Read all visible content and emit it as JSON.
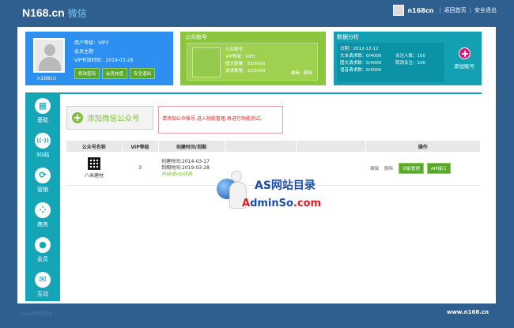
{
  "header": {
    "logo_text": "N168.cn",
    "logo_sub": "微信",
    "username": "n168cn",
    "links": [
      "返回首页",
      "安全退出"
    ]
  },
  "profile": {
    "name": "n168cn",
    "lines": [
      "用户等级：VIP3",
      "会员主题",
      "VIP有效时间：2019-03-28"
    ],
    "buttons": [
      "修改密码",
      "会员充值",
      "安全退出"
    ]
  },
  "account_card": {
    "title": "公众账号",
    "lines": [
      "公众账号：",
      "VIP等级：VIP3",
      "图文数量：33/5000",
      "请求数量：33/5000"
    ],
    "links": [
      "编辑",
      "删除"
    ]
  },
  "stats_card": {
    "title": "数据分析",
    "items": [
      "日期：2012-12-12",
      "",
      "文本请求数：0/4000",
      "关注人数：100",
      "图文请求数：0/4000",
      "取消关注：100",
      "语音请求数：0/4000",
      ""
    ],
    "add_label": "添加账号"
  },
  "sidebar": {
    "items": [
      {
        "label": "基础",
        "icon": "grid-icon",
        "glyph": "▦"
      },
      {
        "label": "3G站",
        "icon": "signal-icon",
        "glyph": "((·))"
      },
      {
        "label": "营销",
        "icon": "refresh-icon",
        "glyph": "⟳"
      },
      {
        "label": "商务",
        "icon": "dots-grid-icon",
        "glyph": "⁘"
      },
      {
        "label": "会员",
        "icon": "user-icon",
        "glyph": "●"
      },
      {
        "label": "互动",
        "icon": "chat-icon",
        "glyph": "✉"
      }
    ]
  },
  "add_wechat": {
    "label": "添加微信公众号",
    "notice": "请添加公众帐号,进入功能管理,再进行功能测试。"
  },
  "table": {
    "headers": [
      "公众号名称",
      "VIP等级",
      "创建时间/到期",
      "",
      "",
      "操作"
    ],
    "rows": [
      {
        "name": "八米建材",
        "vip": "3",
        "created": "创建时间:2014-03-17",
        "expires": "到期时间:2019-03-28",
        "upgrade": "升级或vip续费",
        "links": [
          "编辑",
          "删除"
        ],
        "buttons": [
          "功能管理",
          "API接口"
        ]
      }
    ]
  },
  "watermark": {
    "title": "AS网站目录",
    "domain_a": "A",
    "domain_b": "dminSo",
    "domain_c": ".com"
  },
  "footer": {
    "site": "www.n168.cn",
    "left": "n168微信营销"
  },
  "colors": {
    "page_bg": "#2f5f8f",
    "profile_blue": "#2d8ff0",
    "account_green": "#8cc63f",
    "stats_teal": "#12a0b2",
    "button_green": "#5aa82b",
    "notice_red": "#e02020"
  }
}
